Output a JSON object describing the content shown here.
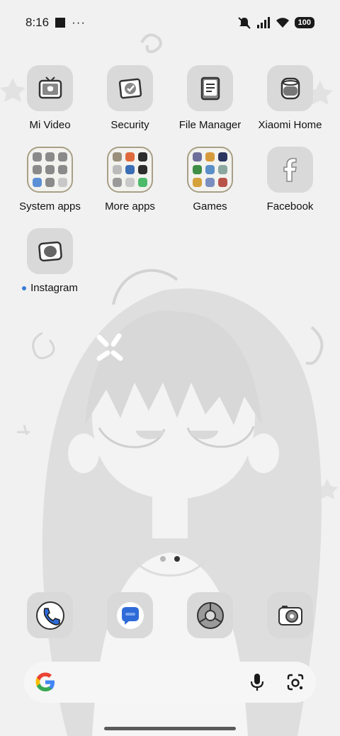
{
  "status_bar": {
    "time": "8:16",
    "more_indicator": "···",
    "battery": "100",
    "icons": [
      "notification-square-icon",
      "mute-icon",
      "signal-icon",
      "wifi-icon",
      "battery-icon"
    ]
  },
  "home_grid": {
    "row1": [
      "Mi Video",
      "Security",
      "File Manager",
      "Xiaomi Home"
    ],
    "row2": [
      "System apps",
      "More apps",
      "Games",
      "Facebook"
    ],
    "row3": [
      "Instagram"
    ]
  },
  "folders": {
    "system_apps": [
      "#8a8a8a",
      "#8a8a8a",
      "#8a8a8a",
      "#8a8a8a",
      "#8a8a8a",
      "#8a8a8a",
      "#5b8fd6",
      "#8a8a8a",
      "#c8c8c8"
    ],
    "more_apps": [
      "#9a8f7a",
      "#e06a3b",
      "#2d2d2d",
      "#bbbbbb",
      "#3a6fb6",
      "#2d2d2d",
      "#9a9a9a",
      "#c9c9c9",
      "#4dbb6a"
    ],
    "games": [
      "#6e6e9a",
      "#d79a3a",
      "#2b3560",
      "#3e8e46",
      "#5a8fc8",
      "#8aa7a0",
      "#d4a13b",
      "#7a8ec0",
      "#b8554a"
    ]
  },
  "page_indicator": {
    "count": 2,
    "active": 2
  },
  "dock": [
    "phone-icon",
    "messages-icon",
    "chrome-icon",
    "camera-icon"
  ],
  "colors": {
    "icon_tile": "#d9d9d9",
    "accent": "#3a7bd5",
    "folder_border": "#a89f86"
  }
}
